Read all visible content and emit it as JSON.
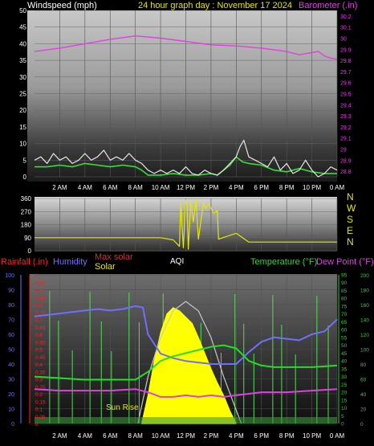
{
  "colors": {
    "background": "#000000",
    "wind": "#e6e6e6",
    "wind_avg": "#35e035",
    "barometer": "#e040e0",
    "wind_dir": "#e6e600",
    "rain": "#ff2020",
    "humidity": "#6f6fff",
    "temperature": "#25dd25",
    "dew_point": "#e040e0",
    "solar": "#ffff00",
    "max_solar": "#c8c8c8",
    "uv": "#9dff9d",
    "aqi": "#cfcfcf",
    "axis_text": "#ffffff",
    "title": "#e6e600"
  },
  "header": {
    "title": "24 hour graph day : November 17 2024",
    "left_label": "Windspeed (mph)",
    "right_label": "Barometer (.in)"
  },
  "direction": {
    "labels": [
      "N",
      "W",
      "S",
      "E",
      "N"
    ]
  },
  "legend": {
    "rainfall": "Rainfall (.in)",
    "humidity": "Humidity",
    "max_solar": "Max solar",
    "solar": "Solar",
    "aqi": "AQI",
    "temperature": "Temperature (°F)",
    "dew_point": "Dew Point (°F)",
    "sunrise": "Sun Rise"
  },
  "chart_data": [
    {
      "type": "line",
      "title": "24 hour graph day : November 17 2024",
      "x": [
        "2 AM",
        "4 AM",
        "6 AM",
        "8 AM",
        "10 AM",
        "12 PM",
        "2 PM",
        "4 PM",
        "6 PM",
        "8 PM",
        "10 PM",
        "0 AM"
      ],
      "y_left": {
        "label": "Windspeed (mph)",
        "ticks": [
          "0",
          "5",
          "10",
          "15",
          "20",
          "25",
          "30",
          "35",
          "40",
          "45",
          "50"
        ],
        "ylim": [
          0,
          50
        ]
      },
      "y_right": {
        "label": "Barometer (.in)",
        "ticks": [
          "28.8",
          "28.9",
          "29",
          "29.1",
          "29.2",
          "29.3",
          "29.4",
          "29.5",
          "29.6",
          "29.7",
          "29.8",
          "29.9",
          "30",
          "30.1",
          "30.2"
        ],
        "ylim": [
          28.75,
          30.25
        ]
      },
      "series": [
        {
          "key": "barometer",
          "hours": [
            0,
            2,
            4,
            6,
            8,
            9,
            10,
            12,
            14,
            16,
            18,
            20,
            21,
            22,
            22.5,
            23,
            23.5,
            24
          ],
          "values": [
            29.88,
            29.91,
            29.95,
            29.99,
            30.02,
            30.01,
            30.0,
            29.97,
            29.94,
            29.93,
            29.91,
            29.88,
            29.85,
            29.87,
            29.88,
            29.84,
            29.82,
            29.81
          ]
        },
        {
          "key": "wind_avg",
          "hours": [
            0,
            1,
            2,
            3,
            4,
            5,
            6,
            7,
            8,
            8.5,
            9,
            10,
            11,
            12,
            13,
            14,
            14.5,
            15,
            15.5,
            16,
            16.5,
            17,
            18,
            19,
            20,
            21,
            22,
            23,
            24
          ],
          "values": [
            3,
            3,
            3.5,
            3,
            4,
            3.5,
            3,
            3.5,
            3,
            2,
            0.5,
            0.5,
            1,
            0.5,
            0.5,
            1,
            0.5,
            2,
            3.5,
            6,
            4.5,
            4,
            3.5,
            2,
            1.5,
            2.5,
            1.5,
            1,
            1
          ]
        },
        {
          "key": "wind",
          "hours": [
            0,
            0.5,
            1,
            1.5,
            2,
            2.5,
            3,
            3.5,
            4,
            4.5,
            5,
            5.5,
            6,
            6.5,
            7,
            7.5,
            8,
            8.5,
            9,
            9.5,
            10,
            10.5,
            11,
            11.5,
            12,
            12.5,
            13,
            13.5,
            14,
            14.5,
            15,
            15.5,
            16,
            16.3,
            16.6,
            17,
            17.5,
            18,
            18.5,
            19,
            19.5,
            20,
            20.5,
            21,
            21.5,
            22,
            22.5,
            23,
            23.5,
            24
          ],
          "values": [
            5,
            6,
            4,
            7,
            5,
            6,
            4,
            5,
            7,
            5,
            6,
            8,
            5,
            6,
            5,
            7,
            5,
            4,
            2,
            1,
            2,
            1,
            2,
            1,
            3,
            1,
            0.5,
            2,
            1,
            0.5,
            2,
            4,
            6,
            9,
            11,
            6,
            5,
            4,
            3,
            6,
            2,
            4,
            1,
            2,
            5,
            2,
            0,
            1,
            3,
            2
          ]
        }
      ]
    },
    {
      "type": "scatter",
      "title": "",
      "x": [
        "2 AM",
        "4 AM",
        "6 AM",
        "8 AM",
        "10 AM",
        "12 PM",
        "2 PM",
        "4 PM",
        "6 PM",
        "8 PM",
        "10 PM",
        "0 AM"
      ],
      "y_left": {
        "label": "",
        "ticks": [
          "0",
          "90",
          "180",
          "270",
          "360"
        ],
        "ylim": [
          0,
          360
        ]
      },
      "y_right_labels": [
        "N",
        "W",
        "S",
        "E",
        "N"
      ],
      "series": [
        {
          "key": "wind_dir",
          "hours": [
            0,
            6,
            10,
            11,
            11.5,
            11.6,
            11.8,
            12,
            12.1,
            12.2,
            12.4,
            12.6,
            12.8,
            13,
            13.4,
            13.6,
            13.8,
            14,
            14.2,
            14.5,
            14.6,
            16,
            17,
            24
          ],
          "values": [
            90,
            90,
            90,
            75,
            30,
            330,
            20,
            350,
            300,
            10,
            340,
            200,
            355,
            80,
            330,
            290,
            320,
            295,
            260,
            275,
            80,
            120,
            60,
            60
          ]
        }
      ]
    },
    {
      "type": "line",
      "title": "",
      "x": [
        "2 AM",
        "4 AM",
        "6 AM",
        "8 AM",
        "10 AM",
        "12 PM",
        "2 PM",
        "4 PM",
        "6 PM",
        "8 PM",
        "10 PM",
        "0 AM"
      ],
      "y_rain": {
        "label": "Rainfall (.in)",
        "ticks": [
          "0",
          "0.05",
          "0.1",
          "0.15",
          "0.2",
          "0.25",
          "0.3",
          "0.35",
          "0.4",
          "0.45",
          "0.5",
          "0.55",
          "0.6",
          "0.65",
          "0.7",
          "0.75",
          "0.8",
          "0.85",
          "0.9",
          "0.95",
          "1"
        ],
        "ylim": [
          0,
          1
        ]
      },
      "y_humidity": {
        "label": "Humidity",
        "ticks": [
          "0",
          "10",
          "20",
          "30",
          "40",
          "50",
          "60",
          "70",
          "80",
          "90",
          "100"
        ],
        "ylim": [
          0,
          100
        ]
      },
      "y_temperature": {
        "label": "Temperature (°F)",
        "ticks": [
          "0",
          "5",
          "10",
          "15",
          "20",
          "25",
          "30",
          "35",
          "40",
          "45",
          "50",
          "55",
          "60",
          "65",
          "70",
          "75",
          "80",
          "85",
          "90",
          "95"
        ],
        "ylim": [
          0,
          95
        ]
      },
      "y_solar": {
        "label": "",
        "ticks": [
          "0",
          "20",
          "40",
          "60",
          "80",
          "100",
          "120",
          "140",
          "160",
          "180",
          "200"
        ],
        "ylim": [
          0,
          200
        ]
      },
      "series": [
        {
          "key": "humidity",
          "hours": [
            0,
            2,
            4,
            5,
            6,
            7,
            8,
            8.6,
            9,
            10,
            11,
            12,
            13,
            14,
            15,
            16,
            17,
            18,
            19,
            20,
            21,
            22,
            23,
            23.5,
            24
          ],
          "values": [
            72,
            74,
            76,
            77,
            76,
            77,
            79,
            78,
            60,
            47,
            44,
            42,
            41,
            40,
            40,
            40,
            48,
            55,
            58,
            57,
            56,
            60,
            62,
            66,
            70
          ]
        },
        {
          "key": "temperature",
          "hours": [
            0,
            2,
            4,
            6,
            8,
            9,
            10,
            11,
            12,
            13,
            14,
            15,
            16,
            17,
            18,
            19,
            20,
            22,
            24
          ],
          "values": [
            30,
            29,
            28,
            28,
            28,
            33,
            40,
            43,
            45,
            47,
            49,
            50,
            48,
            40,
            37,
            36,
            36,
            36,
            37
          ]
        },
        {
          "key": "dew_point",
          "hours": [
            0,
            2,
            4,
            6,
            8,
            9,
            10,
            11,
            12,
            13,
            14,
            15,
            16,
            17,
            18,
            20,
            22,
            24
          ],
          "values": [
            22,
            21,
            21,
            21,
            22,
            20,
            17,
            17,
            18,
            17,
            18,
            17,
            18,
            19,
            20,
            20,
            21,
            22
          ]
        },
        {
          "key": "max_solar",
          "hours": [
            8.2,
            9,
            10,
            11,
            12,
            13,
            14,
            15,
            16.4
          ],
          "values": [
            0,
            30,
            55,
            72,
            78,
            72,
            55,
            30,
            0
          ]
        },
        {
          "key": "solar",
          "hours": [
            8.5,
            9,
            9.5,
            10,
            10.5,
            11,
            11.5,
            12,
            12.5,
            13,
            13.5,
            14,
            14.5,
            15,
            15.5,
            16
          ],
          "values": [
            0,
            18,
            40,
            58,
            70,
            74,
            72,
            68,
            64,
            55,
            45,
            35,
            26,
            18,
            8,
            0
          ]
        }
      ],
      "annotations": [
        "Sun Rise"
      ]
    }
  ]
}
